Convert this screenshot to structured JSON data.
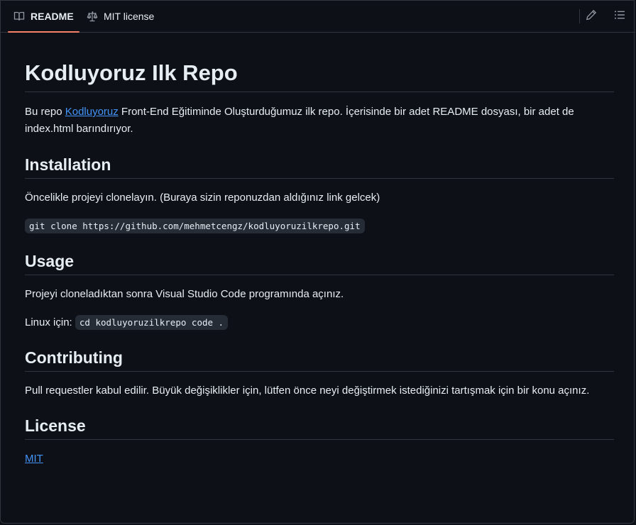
{
  "tabs": {
    "readme_label": "README",
    "license_label": "MIT license"
  },
  "icons": {
    "readme": "book-icon",
    "license": "law-scale-icon",
    "edit": "pencil-icon",
    "outline": "list-unordered-icon"
  },
  "colors": {
    "background": "#0d1117",
    "border": "#30363d",
    "text": "#e6edf3",
    "link": "#4493f8",
    "active_tab_underline": "#f78166",
    "code_bg": "#262c36"
  },
  "readme": {
    "title": "Kodluyoruz Ilk Repo",
    "intro_prefix": "Bu repo ",
    "intro_link": "Kodluyoruz",
    "intro_suffix": " Front-End Eğitiminde Oluşturduğumuz ilk repo. İçerisinde bir adet README dosyası, bir adet de index.html barındırıyor.",
    "installation": {
      "heading": "Installation",
      "text": "Öncelikle projeyi clonelayın. (Buraya sizin reponuzdan aldığınız link gelcek)",
      "code": "git clone https://github.com/mehmetcengz/kodluyoruzilkrepo.git"
    },
    "usage": {
      "heading": "Usage",
      "text": "Projeyi cloneladıktan sonra Visual Studio Code programında açınız.",
      "linux_label": "Linux için: ",
      "linux_code": "cd kodluyoruzilkrepo code ."
    },
    "contributing": {
      "heading": "Contributing",
      "text": "Pull requestler kabul edilir. Büyük değişiklikler için, lütfen önce neyi değiştirmek istediğinizi tartışmak için bir konu açınız."
    },
    "license": {
      "heading": "License",
      "link": "MIT"
    }
  }
}
